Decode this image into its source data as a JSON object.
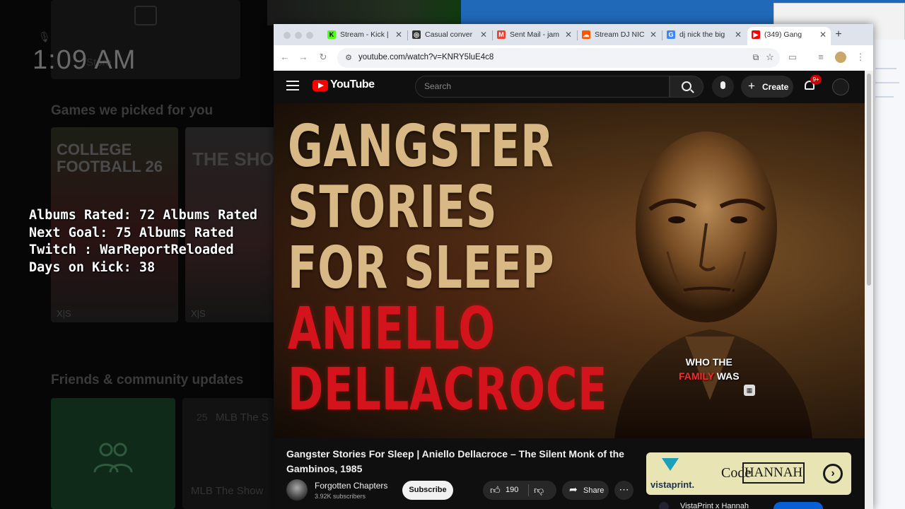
{
  "background": {
    "clock": "1:09 AM",
    "store_label": "Store",
    "games_heading": "Games we picked for you",
    "cfb_title": "COLLEGE\nFOOTBALL 26",
    "show_title": "THE SHOW",
    "xs_label": "X|S",
    "friends_heading": "Friends & community updates",
    "mlb_label": "MLB The S",
    "mlb_num": "25",
    "mlb_label2": "MLB The Show"
  },
  "overlay": {
    "line1": "Albums Rated: 72 Albums Rated",
    "line2": "Next Goal: 75 Albums Rated",
    "line3": "Twitch : WarReportReloaded",
    "line4": "Days on Kick: 38"
  },
  "browser": {
    "tabs": [
      {
        "label": "Stream - Kick |",
        "favicon": "kick-icon",
        "color": "#53fc18",
        "glyph": "K",
        "active": false
      },
      {
        "label": "Casual conver",
        "favicon": "chatgpt-icon",
        "color": "#333333",
        "glyph": "◎",
        "active": false
      },
      {
        "label": "Sent Mail - jam",
        "favicon": "gmail-icon",
        "color": "#ea4335",
        "glyph": "M",
        "active": false
      },
      {
        "label": "Stream DJ NIC",
        "favicon": "soundcloud-icon",
        "color": "#ff5500",
        "glyph": "☁",
        "active": false
      },
      {
        "label": "dj nick the big",
        "favicon": "google-icon",
        "color": "#4285f4",
        "glyph": "G",
        "active": false
      },
      {
        "label": "(349) Gang",
        "favicon": "youtube-icon",
        "color": "#ff0000",
        "glyph": "▶",
        "active": true
      }
    ],
    "newtab": "+",
    "url": "youtube.com/watch?v=KNRY5luE4c8"
  },
  "youtube": {
    "logo_text": "YouTube",
    "search_placeholder": "Search",
    "create_label": "Create",
    "notifications_badge": "9+",
    "thumbnail": {
      "line1": "GANGSTER",
      "line2": "STORIES",
      "line3": "FOR SLEEP",
      "line4": "ANIELLO",
      "line5": "DELLACROCE"
    },
    "caption": {
      "line1": "WHO THE",
      "line2_red": "FAMILY",
      "line2_white": "WAS"
    },
    "video_title": "Gangster Stories For Sleep | Aniello Dellacroce – The Silent Monk of the Gambinos, 1985",
    "channel_name": "Forgotten Chapters",
    "channel_subs": "3.92K subscribers",
    "subscribe_label": "Subscribe",
    "like_count": "190",
    "share_label": "Share",
    "ad": {
      "brand": "vistaprint.",
      "code_label": "Code",
      "code_value": "HANNAH",
      "row_label": "VistaPrint x Hannah"
    }
  }
}
